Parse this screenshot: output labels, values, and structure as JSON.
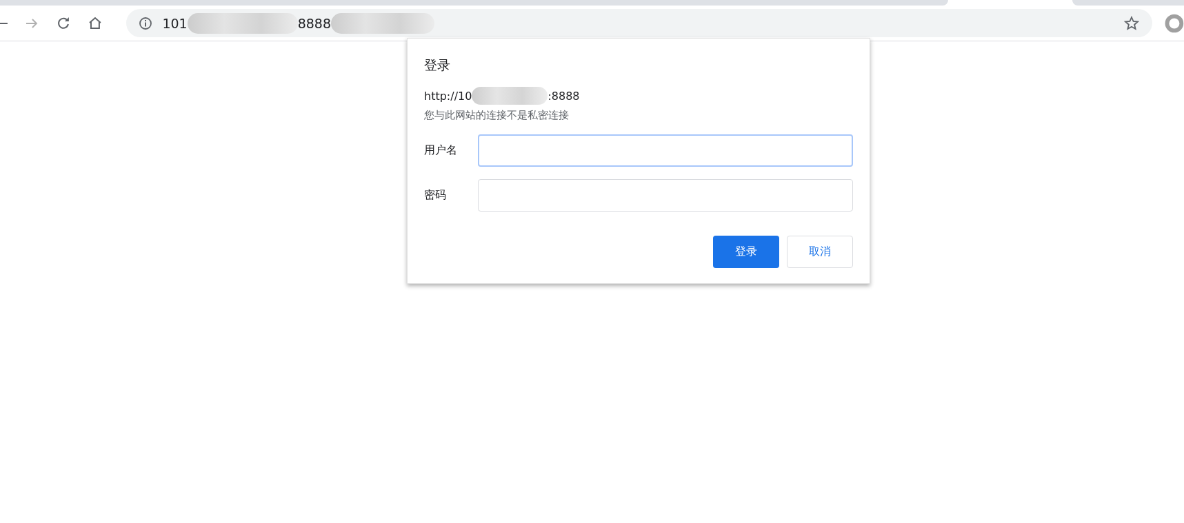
{
  "toolbar": {
    "back": {
      "disabled": false
    },
    "forward": {
      "disabled": true
    },
    "address": {
      "text_start": "101",
      "text_end": "8888"
    }
  },
  "dialog": {
    "title": "登录",
    "origin_start": "http://10",
    "origin_end": ":8888",
    "notice": "您与此网站的连接不是私密连接",
    "fields": [
      {
        "label": "用户名",
        "focused": true
      },
      {
        "label": "密码",
        "focused": false
      }
    ],
    "buttons": [
      {
        "label": "登录",
        "kind": "primary"
      },
      {
        "label": "取消",
        "kind": "secondary"
      }
    ]
  }
}
